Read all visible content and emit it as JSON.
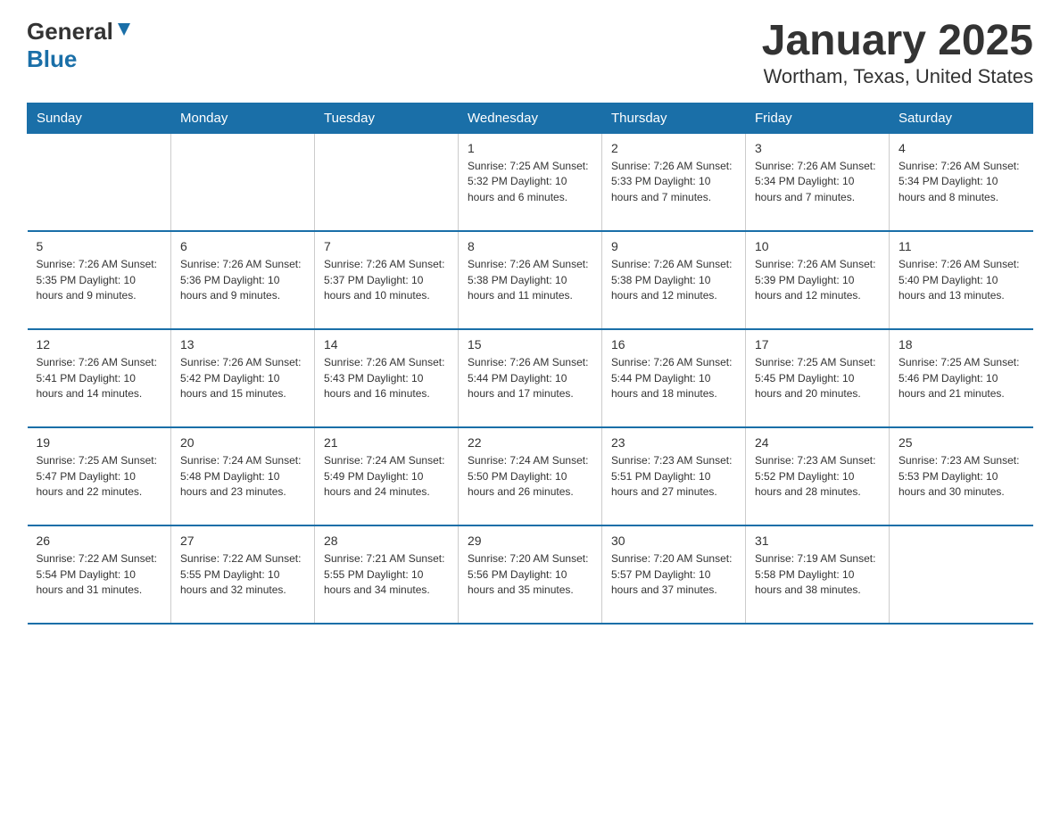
{
  "header": {
    "logo_general": "General",
    "logo_blue": "Blue",
    "title": "January 2025",
    "subtitle": "Wortham, Texas, United States"
  },
  "days_of_week": [
    "Sunday",
    "Monday",
    "Tuesday",
    "Wednesday",
    "Thursday",
    "Friday",
    "Saturday"
  ],
  "weeks": [
    [
      {
        "num": "",
        "info": ""
      },
      {
        "num": "",
        "info": ""
      },
      {
        "num": "",
        "info": ""
      },
      {
        "num": "1",
        "info": "Sunrise: 7:25 AM\nSunset: 5:32 PM\nDaylight: 10 hours and 6 minutes."
      },
      {
        "num": "2",
        "info": "Sunrise: 7:26 AM\nSunset: 5:33 PM\nDaylight: 10 hours and 7 minutes."
      },
      {
        "num": "3",
        "info": "Sunrise: 7:26 AM\nSunset: 5:34 PM\nDaylight: 10 hours and 7 minutes."
      },
      {
        "num": "4",
        "info": "Sunrise: 7:26 AM\nSunset: 5:34 PM\nDaylight: 10 hours and 8 minutes."
      }
    ],
    [
      {
        "num": "5",
        "info": "Sunrise: 7:26 AM\nSunset: 5:35 PM\nDaylight: 10 hours and 9 minutes."
      },
      {
        "num": "6",
        "info": "Sunrise: 7:26 AM\nSunset: 5:36 PM\nDaylight: 10 hours and 9 minutes."
      },
      {
        "num": "7",
        "info": "Sunrise: 7:26 AM\nSunset: 5:37 PM\nDaylight: 10 hours and 10 minutes."
      },
      {
        "num": "8",
        "info": "Sunrise: 7:26 AM\nSunset: 5:38 PM\nDaylight: 10 hours and 11 minutes."
      },
      {
        "num": "9",
        "info": "Sunrise: 7:26 AM\nSunset: 5:38 PM\nDaylight: 10 hours and 12 minutes."
      },
      {
        "num": "10",
        "info": "Sunrise: 7:26 AM\nSunset: 5:39 PM\nDaylight: 10 hours and 12 minutes."
      },
      {
        "num": "11",
        "info": "Sunrise: 7:26 AM\nSunset: 5:40 PM\nDaylight: 10 hours and 13 minutes."
      }
    ],
    [
      {
        "num": "12",
        "info": "Sunrise: 7:26 AM\nSunset: 5:41 PM\nDaylight: 10 hours and 14 minutes."
      },
      {
        "num": "13",
        "info": "Sunrise: 7:26 AM\nSunset: 5:42 PM\nDaylight: 10 hours and 15 minutes."
      },
      {
        "num": "14",
        "info": "Sunrise: 7:26 AM\nSunset: 5:43 PM\nDaylight: 10 hours and 16 minutes."
      },
      {
        "num": "15",
        "info": "Sunrise: 7:26 AM\nSunset: 5:44 PM\nDaylight: 10 hours and 17 minutes."
      },
      {
        "num": "16",
        "info": "Sunrise: 7:26 AM\nSunset: 5:44 PM\nDaylight: 10 hours and 18 minutes."
      },
      {
        "num": "17",
        "info": "Sunrise: 7:25 AM\nSunset: 5:45 PM\nDaylight: 10 hours and 20 minutes."
      },
      {
        "num": "18",
        "info": "Sunrise: 7:25 AM\nSunset: 5:46 PM\nDaylight: 10 hours and 21 minutes."
      }
    ],
    [
      {
        "num": "19",
        "info": "Sunrise: 7:25 AM\nSunset: 5:47 PM\nDaylight: 10 hours and 22 minutes."
      },
      {
        "num": "20",
        "info": "Sunrise: 7:24 AM\nSunset: 5:48 PM\nDaylight: 10 hours and 23 minutes."
      },
      {
        "num": "21",
        "info": "Sunrise: 7:24 AM\nSunset: 5:49 PM\nDaylight: 10 hours and 24 minutes."
      },
      {
        "num": "22",
        "info": "Sunrise: 7:24 AM\nSunset: 5:50 PM\nDaylight: 10 hours and 26 minutes."
      },
      {
        "num": "23",
        "info": "Sunrise: 7:23 AM\nSunset: 5:51 PM\nDaylight: 10 hours and 27 minutes."
      },
      {
        "num": "24",
        "info": "Sunrise: 7:23 AM\nSunset: 5:52 PM\nDaylight: 10 hours and 28 minutes."
      },
      {
        "num": "25",
        "info": "Sunrise: 7:23 AM\nSunset: 5:53 PM\nDaylight: 10 hours and 30 minutes."
      }
    ],
    [
      {
        "num": "26",
        "info": "Sunrise: 7:22 AM\nSunset: 5:54 PM\nDaylight: 10 hours and 31 minutes."
      },
      {
        "num": "27",
        "info": "Sunrise: 7:22 AM\nSunset: 5:55 PM\nDaylight: 10 hours and 32 minutes."
      },
      {
        "num": "28",
        "info": "Sunrise: 7:21 AM\nSunset: 5:55 PM\nDaylight: 10 hours and 34 minutes."
      },
      {
        "num": "29",
        "info": "Sunrise: 7:20 AM\nSunset: 5:56 PM\nDaylight: 10 hours and 35 minutes."
      },
      {
        "num": "30",
        "info": "Sunrise: 7:20 AM\nSunset: 5:57 PM\nDaylight: 10 hours and 37 minutes."
      },
      {
        "num": "31",
        "info": "Sunrise: 7:19 AM\nSunset: 5:58 PM\nDaylight: 10 hours and 38 minutes."
      },
      {
        "num": "",
        "info": ""
      }
    ]
  ]
}
